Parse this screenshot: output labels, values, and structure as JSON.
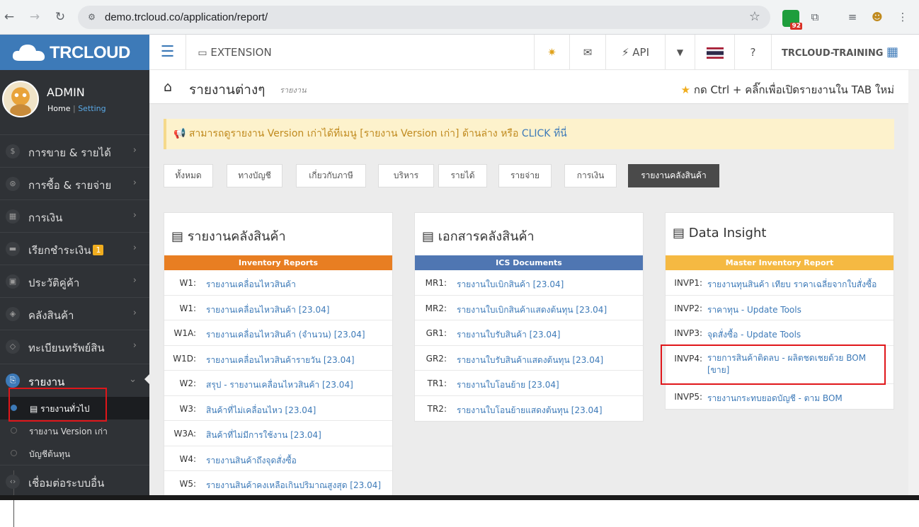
{
  "browser": {
    "url": "demo.trcloud.co/application/report/",
    "ext_badge_count": "92"
  },
  "brand": {
    "name": "TRCLOUD"
  },
  "topbar": {
    "extension": "EXTENSION",
    "api": "API",
    "company": "TRCLOUD-TRAINING"
  },
  "profile": {
    "name": "ADMIN",
    "home": "Home",
    "separator": "|",
    "setting": "Setting"
  },
  "sidebar": {
    "items": [
      {
        "label": "การขาย & รายได้",
        "icon": "dollar-icon"
      },
      {
        "label": "การซื้อ & รายจ่าย",
        "icon": "cart-icon"
      },
      {
        "label": "การเงิน",
        "icon": "calendar-icon"
      },
      {
        "label": "เรียกชำระเงิน",
        "icon": "card-icon",
        "badge": "1"
      },
      {
        "label": "ประวัติคู่ค้า",
        "icon": "contact-icon"
      },
      {
        "label": "คลังสินค้า",
        "icon": "cubes-icon"
      },
      {
        "label": "ทะเบียนทรัพย์สิน",
        "icon": "diamond-icon"
      },
      {
        "label": "รายงาน",
        "icon": "report-icon"
      }
    ],
    "sub_items": [
      "รายงานทั่วไป",
      "รายงาน Version เก่า",
      "บัญชีต้นทุน"
    ],
    "last_item": "เชื่อมต่อระบบอื่น"
  },
  "page": {
    "title": "รายงานต่างๆ",
    "subtitle": "รายงาน",
    "hint": "กด Ctrl + คลิ๊กเพื่อเปิดรายงานใน TAB ใหม่"
  },
  "alert": {
    "text": "สามารถดูรายงาน Version เก่าได้ที่เมนู [รายงาน Version เก่า] ด้านล่าง หรือ",
    "click": "CLICK ที่นี่"
  },
  "tabs": [
    "ทั้งหมด",
    "ทางบัญชี",
    "เกี่ยวกับภาษี",
    "บริหาร",
    "รายได้",
    "รายจ่าย",
    "การเงิน",
    "รายงานคลังสินค้า"
  ],
  "cards": [
    {
      "title": "รายงานคลังสินค้า",
      "band": "Inventory Reports",
      "band_color": "#e87e22",
      "rows": [
        {
          "code": "W1:",
          "label": "รายงานเคลื่อนไหวสินค้า"
        },
        {
          "code": "W1:",
          "label": "รายงานเคลื่อนไหวสินค้า [23.04]"
        },
        {
          "code": "W1A:",
          "label": "รายงานเคลื่อนไหวสินค้า (จำนวน) [23.04]"
        },
        {
          "code": "W1D:",
          "label": "รายงานเคลื่อนไหวสินค้ารายวัน [23.04]"
        },
        {
          "code": "W2:",
          "label": "สรุป - รายงานเคลื่อนไหวสินค้า [23.04]"
        },
        {
          "code": "W3:",
          "label": "สินค้าที่ไม่เคลื่อนไหว [23.04]"
        },
        {
          "code": "W3A:",
          "label": "สินค้าที่ไม่มีการใช้งาน [23.04]"
        },
        {
          "code": "W4:",
          "label": "รายงานสินค้าถึงจุดสั่งซื้อ"
        },
        {
          "code": "W5:",
          "label": "รายงานสินค้าคงเหลือเกินปริมาณสูงสุด [23.04]"
        }
      ]
    },
    {
      "title": "เอกสารคลังสินค้า",
      "band": "ICS Documents",
      "band_color": "#4f76b2",
      "rows": [
        {
          "code": "MR1:",
          "label": "รายงานใบเบิกสินค้า [23.04]"
        },
        {
          "code": "MR2:",
          "label": "รายงานใบเบิกสินค้าแสดงต้นทุน [23.04]"
        },
        {
          "code": "GR1:",
          "label": "รายงานใบรับสินค้า [23.04]"
        },
        {
          "code": "GR2:",
          "label": "รายงานใบรับสินค้าแสดงต้นทุน [23.04]"
        },
        {
          "code": "TR1:",
          "label": "รายงานใบโอนย้าย [23.04]"
        },
        {
          "code": "TR2:",
          "label": "รายงานใบโอนย้ายแสดงต้นทุน [23.04]"
        }
      ]
    },
    {
      "title": "Data Insight",
      "band": "Master Inventory Report",
      "band_color": "#f5b942",
      "rows": [
        {
          "code": "INVP1:",
          "label": "รายงานทุนสินค้า เทียบ ราคาเฉลี่ยจากใบสั่งซื้อ"
        },
        {
          "code": "INVP2:",
          "label": "ราคาทุน - Update Tools"
        },
        {
          "code": "INVP3:",
          "label": "จุดสั่งซื้อ - Update Tools"
        },
        {
          "code": "INVP4:",
          "label": "รายการสินค้าติดลบ - ผลิตชดเชยด้วย BOM [ขาย]"
        },
        {
          "code": "INVP5:",
          "label": "รายงานกระทบยอดบัญชี - ตาม BOM"
        }
      ]
    }
  ]
}
